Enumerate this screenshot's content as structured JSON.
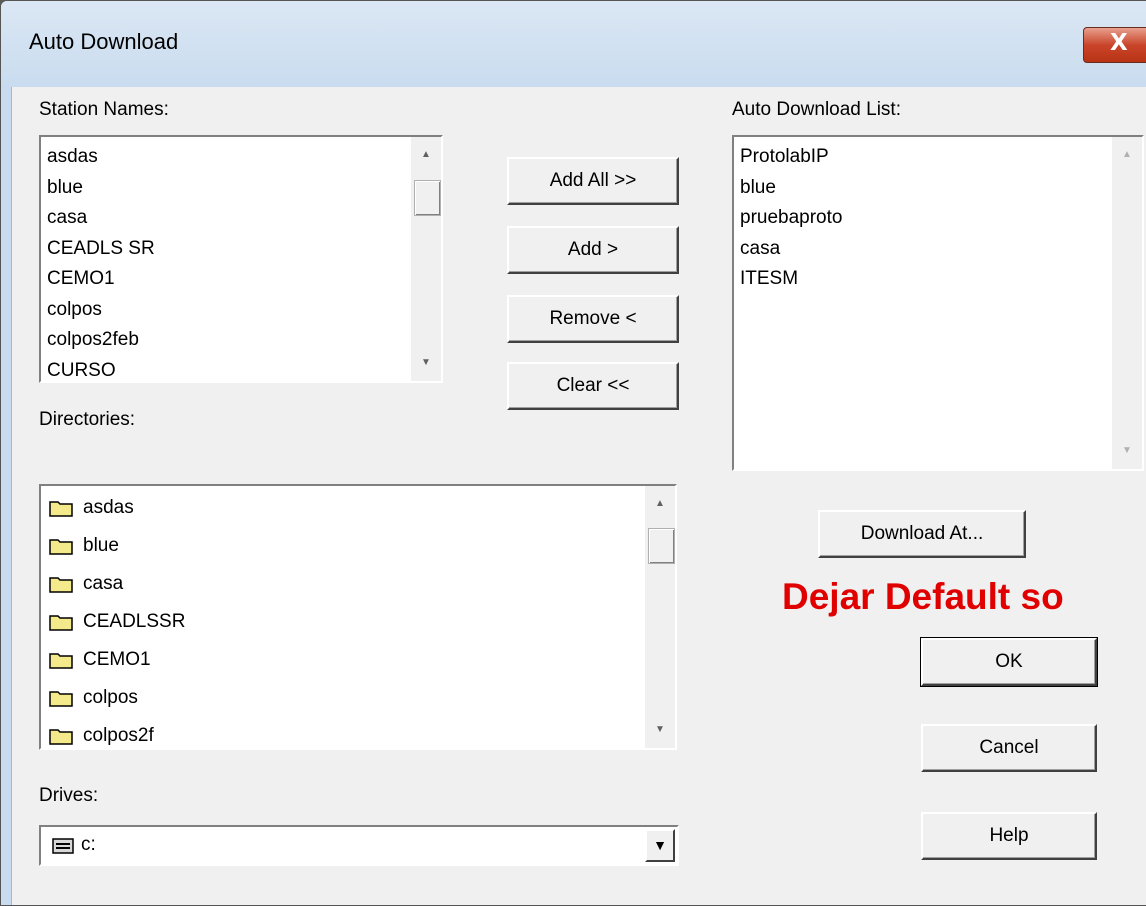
{
  "window": {
    "title": "Auto Download",
    "close_glyph": "X"
  },
  "station": {
    "label": "Station Names:",
    "items": [
      "asdas",
      "blue",
      "casa",
      "CEADLS SR",
      "CEMO1",
      "colpos",
      "colpos2feb",
      "CURSO"
    ]
  },
  "auto_list": {
    "label": "Auto Download List:",
    "items": [
      "ProtolabIP",
      "blue",
      "pruebaproto",
      "casa",
      "ITESM"
    ]
  },
  "buttons": {
    "add_all": "Add All >>",
    "add": "Add >",
    "remove": "Remove <",
    "clear": "Clear <<",
    "download_at": "Download At...",
    "ok": "OK",
    "cancel": "Cancel",
    "help": "Help"
  },
  "directories": {
    "label": "Directories:",
    "items": [
      "asdas",
      "blue",
      "casa",
      "CEADLSSR",
      "CEMO1",
      "colpos",
      "colpos2f"
    ]
  },
  "drives": {
    "label": "Drives:",
    "selected": "c:"
  },
  "annotation": {
    "text": "Dejar Default so",
    "color": "#e00000"
  },
  "icons": [
    "close-icon",
    "scroll-up-arrow-icon",
    "scroll-down-arrow-icon",
    "folder-icon",
    "drive-icon",
    "dropdown-arrow-icon"
  ]
}
